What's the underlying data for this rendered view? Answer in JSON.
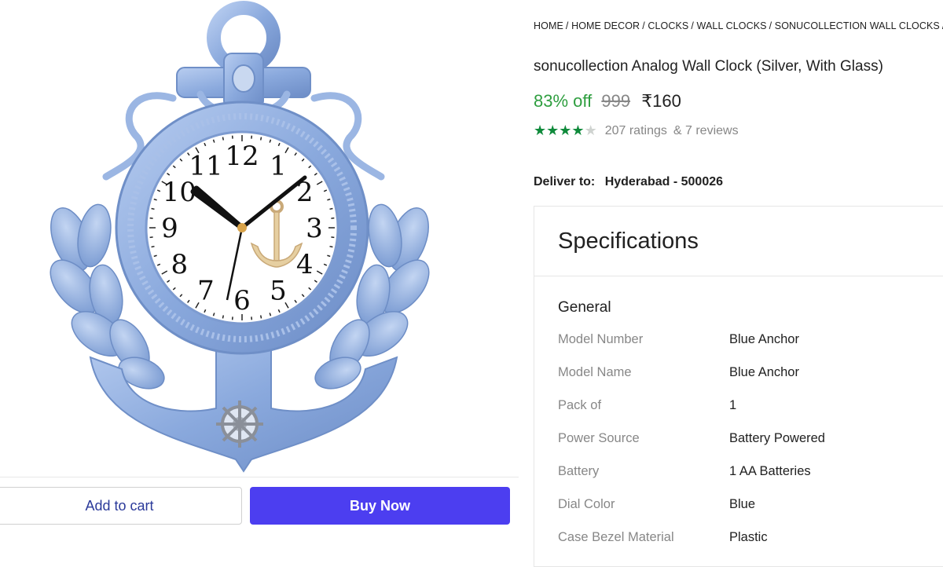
{
  "breadcrumb": [
    "HOME",
    "HOME DECOR",
    "CLOCKS",
    "WALL CLOCKS",
    "SONUCOLLECTION WALL CLOCKS",
    "S"
  ],
  "product": {
    "title": "sonucollection Analog Wall Clock (Silver, With Glass)",
    "discount": "83% off",
    "mrp": "999",
    "price": "₹160",
    "rating_stars": 4,
    "ratings_text": "207 ratings",
    "reviews_text": "& 7 reviews"
  },
  "delivery": {
    "label": "Deliver to:",
    "location": "Hyderabad - 500026"
  },
  "specs": {
    "title": "Specifications",
    "group": "General",
    "rows": [
      {
        "key": "Model Number",
        "value": "Blue Anchor"
      },
      {
        "key": "Model Name",
        "value": "Blue Anchor"
      },
      {
        "key": "Pack of",
        "value": "1"
      },
      {
        "key": "Power Source",
        "value": "Battery Powered"
      },
      {
        "key": "Battery",
        "value": "1 AA Batteries"
      },
      {
        "key": "Dial Color",
        "value": "Blue"
      },
      {
        "key": "Case Bezel Material",
        "value": "Plastic"
      }
    ]
  },
  "actions": {
    "add_to_cart": "Add to cart",
    "buy_now": "Buy Now"
  },
  "clock_numerals": [
    "12",
    "1",
    "2",
    "3",
    "4",
    "5",
    "6",
    "7",
    "8",
    "9",
    "10",
    "11"
  ],
  "colors": {
    "accent": "#4c3ef0",
    "discount": "#2e9e3f",
    "star": "#0f8a3b",
    "clock_blue": "#8fb0e3"
  },
  "icons": {
    "product_image": "anchor-wall-clock"
  }
}
